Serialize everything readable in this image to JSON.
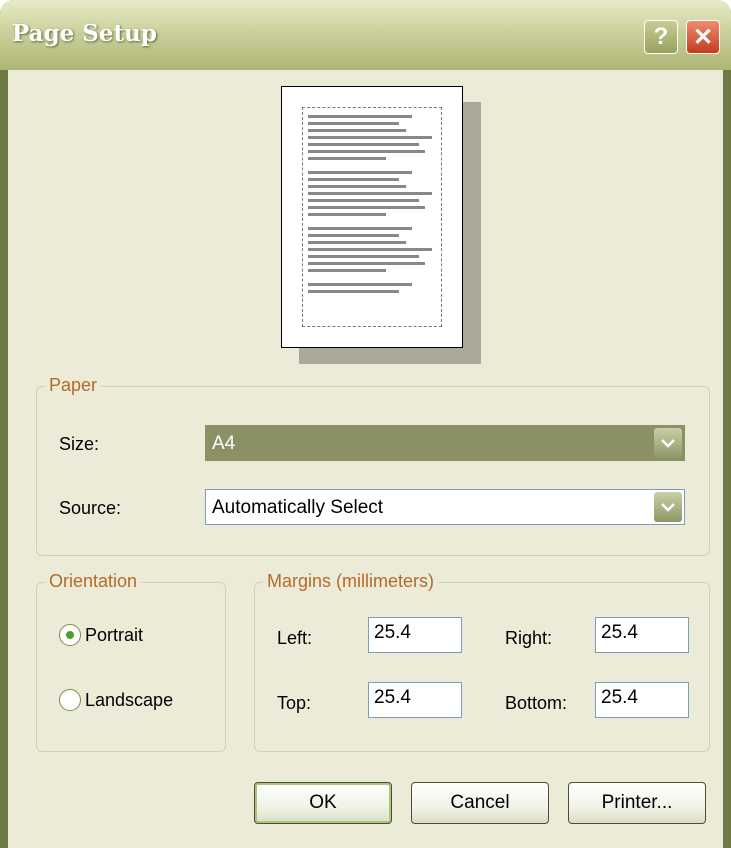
{
  "window": {
    "title": "Page Setup",
    "help_glyph": "?",
    "close_glyph": "✕"
  },
  "paper": {
    "legend": "Paper",
    "size_label": "Size:",
    "size_value": "A4",
    "source_label": "Source:",
    "source_value": "Automatically Select"
  },
  "orientation": {
    "legend": "Orientation",
    "portrait_label": "Portrait",
    "landscape_label": "Landscape",
    "selected": "Portrait"
  },
  "margins": {
    "legend": "Margins (millimeters)",
    "left_label": "Left:",
    "left_value": "25.4",
    "right_label": "Right:",
    "right_value": "25.4",
    "top_label": "Top:",
    "top_value": "25.4",
    "bottom_label": "Bottom:",
    "bottom_value": "25.4"
  },
  "buttons": {
    "ok": "OK",
    "cancel": "Cancel",
    "printer": "Printer..."
  },
  "colors": {
    "accent": "#b56a2a",
    "title_bar": "#aeb676",
    "close": "#c43c1e"
  }
}
